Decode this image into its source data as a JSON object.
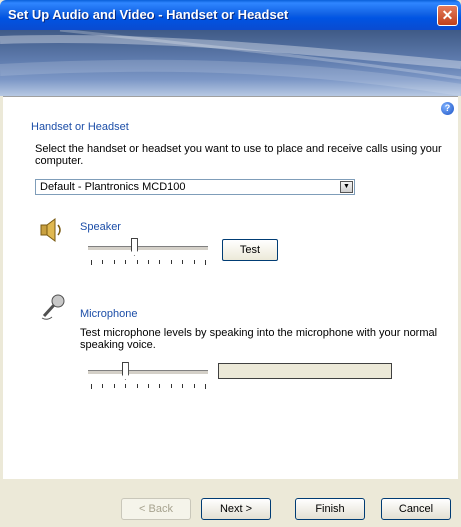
{
  "window": {
    "title": "Set Up Audio and Video - Handset or Headset",
    "close_glyph": "✕"
  },
  "help": {
    "glyph": "?"
  },
  "section": {
    "heading": "Handset or Headset",
    "instruction": "Select the handset or headset you want to use to place and receive calls using your computer."
  },
  "device_select": {
    "value": "Default - Plantronics MCD100",
    "arrow": "▼"
  },
  "speaker": {
    "label": "Speaker",
    "icon": "speaker-icon",
    "volume_level": 0.38,
    "test_label": "Test"
  },
  "microphone": {
    "label": "Microphone",
    "icon": "microphone-icon",
    "description": "Test microphone levels by speaking into the microphone with your normal speaking voice.",
    "volume_level": 0.3,
    "meter_level": 0
  },
  "footer": {
    "back_label": "< Back",
    "next_label": "Next >",
    "finish_label": "Finish",
    "cancel_label": "Cancel"
  },
  "colors": {
    "titlebar": "#0054e3",
    "heading": "#1c4ea8",
    "dialog_bg": "#ece9d8"
  }
}
